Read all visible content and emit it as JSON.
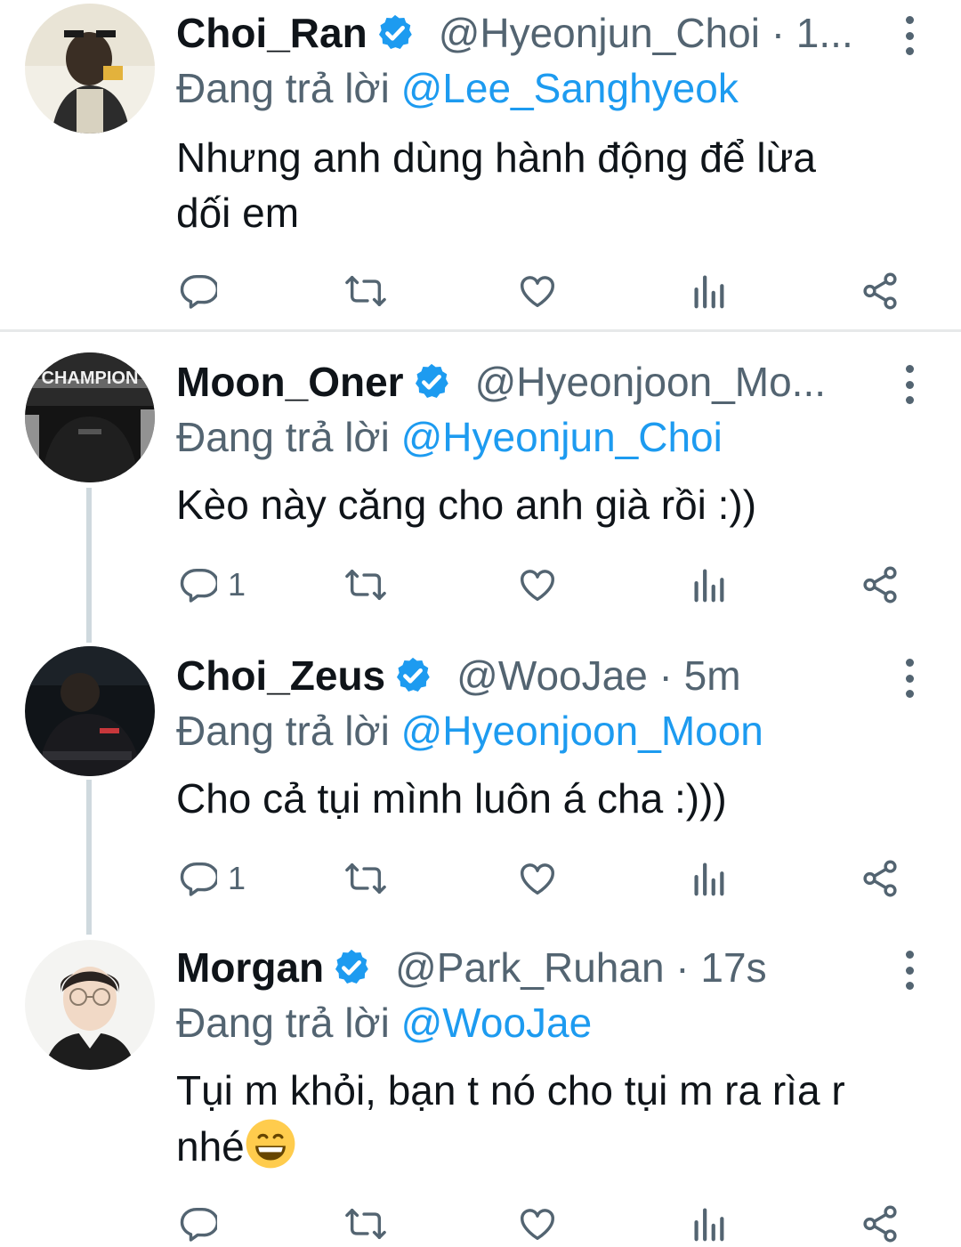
{
  "colors": {
    "text": "#0f1419",
    "secondary": "#536471",
    "link": "#1d9bf0",
    "verified": "#1d9bf0",
    "thread_line": "#cfd9de"
  },
  "reply_prefix": "Đang trả lời",
  "tweets": [
    {
      "name": "Choi_Ran",
      "meta": "@Hyeonjun_Choi · 1...",
      "reply_handle": "@Lee_Sanghyeok",
      "text_lines": [
        "Nhưng anh dùng hành động để lừa",
        "dối em"
      ],
      "reply_count": "",
      "avatar_icon": "avatar-photo"
    },
    {
      "name": "Moon_Oner",
      "meta": "@Hyeonjoon_Mo...",
      "reply_handle": "@Hyeonjun_Choi",
      "text_lines": [
        "Kèo này căng cho anh già rồi :))"
      ],
      "reply_count": "1",
      "avatar_icon": "avatar-photo"
    },
    {
      "name": "Choi_Zeus",
      "meta": "@WooJae · 5m",
      "reply_handle": "@Hyeonjoon_Moon",
      "text_lines": [
        "Cho cả tụi mình luôn á cha :)))"
      ],
      "reply_count": "1",
      "avatar_icon": "avatar-photo"
    },
    {
      "name": "Morgan",
      "meta": "@Park_Ruhan · 17s",
      "reply_handle": "@WooJae",
      "text_lines": [
        "Tụi m khỏi, bạn t nó cho tụi m ra rìa r",
        "nhé"
      ],
      "reply_count": "",
      "avatar_icon": "avatar-photo",
      "emoji": "grinning-face-emoji"
    }
  ],
  "avatar_labels": {
    "moon_shirt": "CHAMPION"
  }
}
